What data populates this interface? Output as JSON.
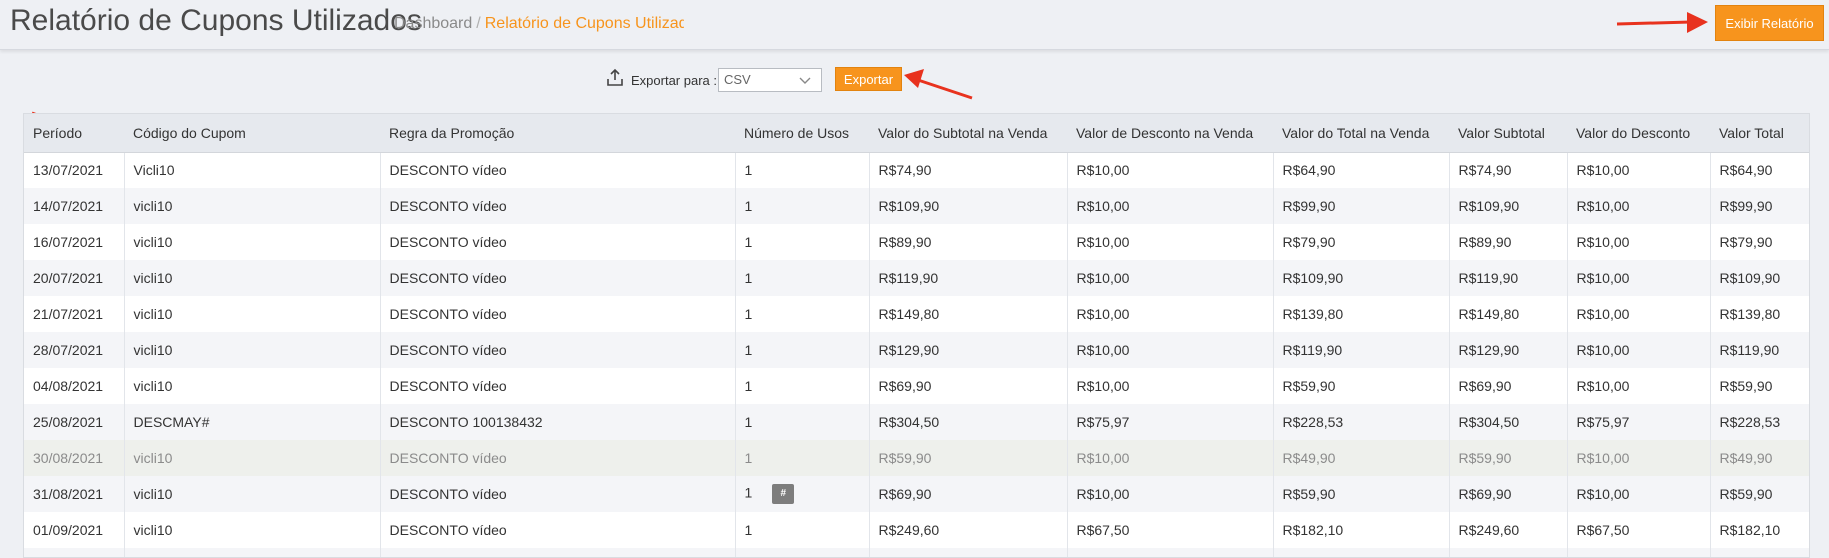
{
  "header": {
    "title": "Relatório de Cupons Utilizados",
    "breadcrumb_home": "Dashboard",
    "breadcrumb_sep": "/",
    "breadcrumb_current": "Relatório de Cupons Utilizados",
    "report_button": "Exibir Relatório"
  },
  "export": {
    "label": "Exportar para :",
    "format": "CSV",
    "button": "Exportar"
  },
  "colors": {
    "accent": "#f7941d",
    "arrow": "#e8321e"
  },
  "table": {
    "columns": [
      "Período",
      "Código do Cupom",
      "Regra da Promoção",
      "Número de Usos",
      "Valor do Subtotal na Venda",
      "Valor de Desconto na Venda",
      "Valor do Total na Venda",
      "Valor Subtotal",
      "Valor do Desconto",
      "Valor Total"
    ],
    "row_action_label": "#",
    "rows": [
      [
        "13/07/2021",
        "Vicli10",
        "DESCONTO vídeo",
        "1",
        "R$74,90",
        "R$10,00",
        "R$64,90",
        "R$74,90",
        "R$10,00",
        "R$64,90"
      ],
      [
        "14/07/2021",
        "vicli10",
        "DESCONTO vídeo",
        "1",
        "R$109,90",
        "R$10,00",
        "R$99,90",
        "R$109,90",
        "R$10,00",
        "R$99,90"
      ],
      [
        "16/07/2021",
        "vicli10",
        "DESCONTO vídeo",
        "1",
        "R$89,90",
        "R$10,00",
        "R$79,90",
        "R$89,90",
        "R$10,00",
        "R$79,90"
      ],
      [
        "20/07/2021",
        "vicli10",
        "DESCONTO vídeo",
        "1",
        "R$119,90",
        "R$10,00",
        "R$109,90",
        "R$119,90",
        "R$10,00",
        "R$109,90"
      ],
      [
        "21/07/2021",
        "vicli10",
        "DESCONTO vídeo",
        "1",
        "R$149,80",
        "R$10,00",
        "R$139,80",
        "R$149,80",
        "R$10,00",
        "R$139,80"
      ],
      [
        "28/07/2021",
        "vicli10",
        "DESCONTO vídeo",
        "1",
        "R$129,90",
        "R$10,00",
        "R$119,90",
        "R$129,90",
        "R$10,00",
        "R$119,90"
      ],
      [
        "04/08/2021",
        "vicli10",
        "DESCONTO vídeo",
        "1",
        "R$69,90",
        "R$10,00",
        "R$59,90",
        "R$69,90",
        "R$10,00",
        "R$59,90"
      ],
      [
        "25/08/2021",
        "DESCMAY#",
        "DESCONTO 100138432",
        "1",
        "R$304,50",
        "R$75,97",
        "R$228,53",
        "R$304,50",
        "R$75,97",
        "R$228,53"
      ],
      [
        "30/08/2021",
        "vicli10",
        "DESCONTO vídeo",
        "1",
        "R$59,90",
        "R$10,00",
        "R$49,90",
        "R$59,90",
        "R$10,00",
        "R$49,90"
      ],
      [
        "31/08/2021",
        "vicli10",
        "DESCONTO vídeo",
        "1",
        "R$69,90",
        "R$10,00",
        "R$59,90",
        "R$69,90",
        "R$10,00",
        "R$59,90"
      ],
      [
        "01/09/2021",
        "vicli10",
        "DESCONTO vídeo",
        "1",
        "R$249,60",
        "R$67,50",
        "R$182,10",
        "R$249,60",
        "R$67,50",
        "R$182,10"
      ],
      [
        "",
        "",
        "",
        "",
        "",
        "",
        "",
        "",
        "",
        ""
      ]
    ]
  }
}
